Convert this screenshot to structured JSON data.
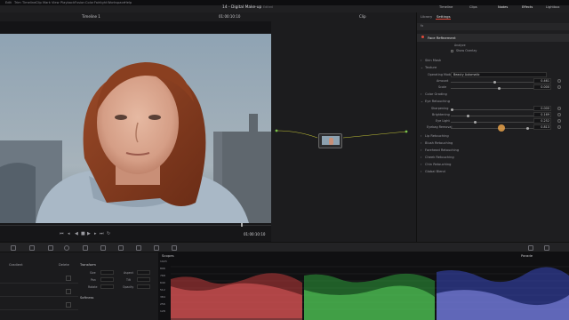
{
  "menubar": {
    "items": [
      "Edit",
      "Trim",
      "Timeline",
      "Clip",
      "Mark",
      "View",
      "Playback",
      "Fusion",
      "Color",
      "Fairlight",
      "Workspace",
      "Help"
    ]
  },
  "toolbar": {
    "project_title": "14 - Digital Make-up",
    "edited": "Edited",
    "timeline_label": "Timeline 1",
    "timecode": "01:00:10:10",
    "clip_label": "Clip",
    "right_items": [
      "Timeline",
      "Clips",
      "Nodes",
      "Effects",
      "Lightbox"
    ]
  },
  "transport": {
    "timecode": "01:00:10:10"
  },
  "panel": {
    "tabs": [
      "Library",
      "Settings"
    ],
    "fx_label": "Face Refinement",
    "analyze": "Analyze",
    "show_overlay": "Show Overlay",
    "section_skin_mask": "Skin Mask",
    "section_texture": "Texture",
    "operating_mode_label": "Operating Mode",
    "operating_mode_value": "Beauty Automatic",
    "amount_label": "Amount",
    "amount_value": "0.461",
    "scale_label": "Scale",
    "scale_value": "0.000",
    "section_color_grading": "Color Grading",
    "section_eye": "Eye Retouching",
    "sharpening_label": "Sharpening",
    "sharpening_value": "0.000",
    "brightening_label": "Brightening",
    "brightening_value": "0.169",
    "eye_light_label": "Eye Light",
    "eye_light_value": "0.252",
    "eyebag_label": "Eyebag Removal",
    "eyebag_value": "0.813",
    "more_sections": [
      "Lip Retouching",
      "Blush Retouching",
      "Forehead Retouching",
      "Cheek Retouching",
      "Chin Retouching",
      "Global Blend"
    ]
  },
  "lowerleft": {
    "labels": [
      "Gradient",
      "Delete",
      "Transform",
      "Softness"
    ],
    "field_labels": [
      "Size",
      "Aspect",
      "Pan",
      "Tilt",
      "Rotate",
      "Opacity"
    ]
  },
  "scopes": {
    "title": "Scopes",
    "mode": "Parade",
    "ticks": [
      "1023",
      "896",
      "768",
      "640",
      "512",
      "384",
      "256",
      "128"
    ]
  },
  "slider_levels": {
    "amount": 0.461,
    "brightening": 0.169,
    "eye_light": 0.252,
    "eyebag": 0.813,
    "sharpening": 0.0
  }
}
